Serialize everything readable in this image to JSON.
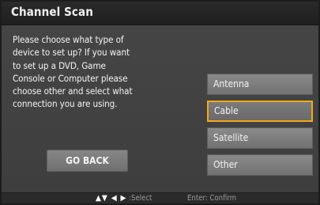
{
  "window": {
    "title": "Channel Scan"
  },
  "prompt": {
    "lines": [
      "Please choose what type of",
      "device to set up? If you want",
      "to set up a DVD, Game",
      "Console or Computer please",
      "choose other and select what",
      "connection you are using."
    ]
  },
  "buttons": {
    "go_back": "GO BACK"
  },
  "options": [
    {
      "label": "Antenna",
      "selected": false
    },
    {
      "label": "Cable",
      "selected": true
    },
    {
      "label": "Satellite",
      "selected": false
    },
    {
      "label": "Other",
      "selected": false
    }
  ],
  "footer": {
    "arrows": "▲▼ ◀ ▶",
    "select_label": ":Select",
    "confirm_label": "Enter: Confirm"
  },
  "colors": {
    "selection_outline": "#f3a819",
    "button_gray": "#7c7c7c",
    "panel_gray": "#424242"
  }
}
